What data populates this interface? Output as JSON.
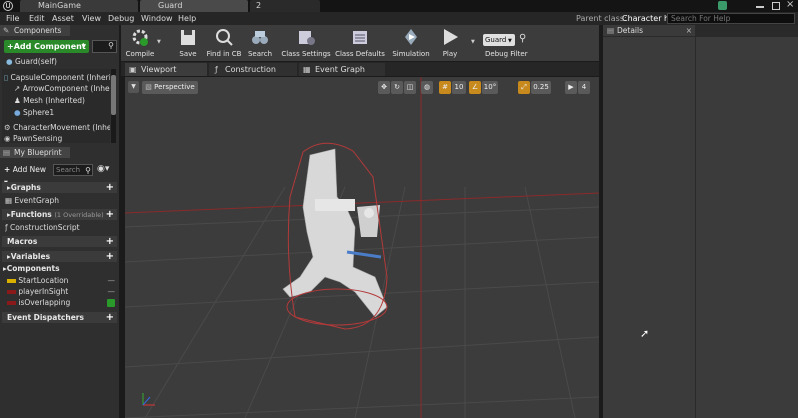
{
  "titlebar": {
    "tabs": [
      "MainGame",
      "Guard",
      "2"
    ],
    "parent_class_label": "Parent class:",
    "parent_class_value": "Character h",
    "search_placeholder": "Search For Help"
  },
  "menu": [
    "File",
    "Edit",
    "Asset",
    "View",
    "Debug",
    "Window",
    "Help"
  ],
  "components_panel": {
    "title": "Components",
    "add_button": "+Add Component",
    "self_item": "Guard(self)",
    "items": [
      "CapsuleComponent (Inherite",
      "ArrowComponent (Inherite",
      "Mesh (Inherited)",
      "Sphere1",
      "CharacterMovement (Inherit",
      "PawnSensing"
    ]
  },
  "my_blueprint": {
    "title": "My Blueprint",
    "add_new": "Add New",
    "search_placeholder": "Search",
    "sections": {
      "graphs": "Graphs",
      "event_graph": "EventGraph",
      "functions": "Functions",
      "functions_note": "(1 Overridable)",
      "construction_script": "ConstructionScript",
      "macros": "Macros",
      "variables": "Variables",
      "components": "Components",
      "event_dispatchers": "Event Dispatchers"
    },
    "variables": [
      "StartLocation",
      "playerInSight",
      "isOverlapping"
    ]
  },
  "toolbar": {
    "buttons": [
      "Compile",
      "Save",
      "Find in CB",
      "Search",
      "Class Settings",
      "Class Defaults",
      "Simulation",
      "Play"
    ],
    "debug_select": "Guard",
    "debug_filter": "Debug Filter"
  },
  "editor_tabs": [
    "Viewport",
    "Construction Script",
    "Event Graph"
  ],
  "viewport": {
    "perspective": "Perspective",
    "grid_snap": "10",
    "rotation_snap": "10°",
    "scale_snap": "0.25",
    "camera_speed": "4"
  },
  "details": {
    "title": "Details"
  },
  "colors": {
    "accent_green": "#2a8a2a",
    "capsule_red": "#b33a3a",
    "snap_orange": "#c88a1c"
  }
}
